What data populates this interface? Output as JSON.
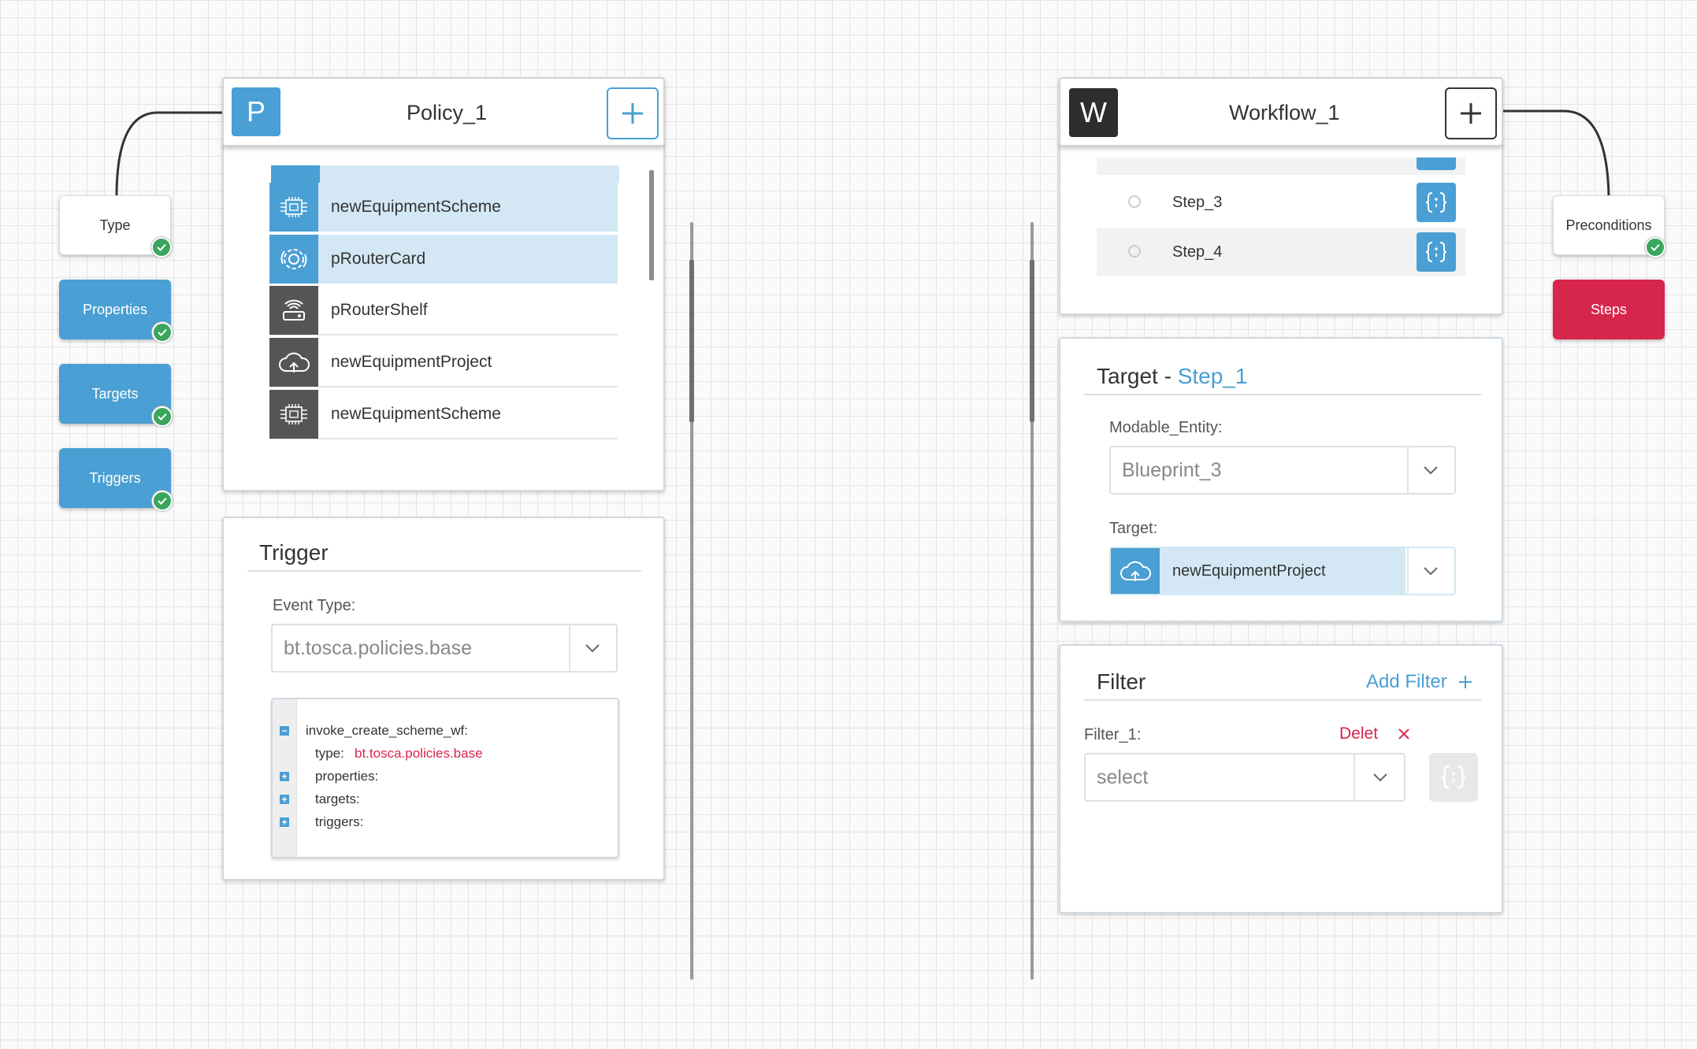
{
  "policy": {
    "badge": "P",
    "title": "Policy_1",
    "add_icon": "plus-icon",
    "nodes": [
      {
        "label": "Type",
        "checked": true
      },
      {
        "label": "Properties",
        "checked": true
      },
      {
        "label": "Targets",
        "checked": true
      },
      {
        "label": "Triggers",
        "checked": true
      }
    ],
    "items": [
      {
        "label": "newEquipmentScheme",
        "icon": "chip-icon",
        "selected": true
      },
      {
        "label": "pRouterCard",
        "icon": "gear-icon",
        "selected": true
      },
      {
        "label": "pRouterShelf",
        "icon": "router-icon",
        "selected": false
      },
      {
        "label": "newEquipmentProject",
        "icon": "cloud-icon",
        "selected": false
      },
      {
        "label": "newEquipmentScheme",
        "icon": "chip-icon",
        "selected": false
      }
    ],
    "trigger": {
      "title": "Trigger",
      "event_type_label": "Event Type:",
      "event_type_value": "bt.tosca.policies.base",
      "code": {
        "root": "invoke_create_scheme_wf:",
        "type_key": "type:",
        "type_value": "bt.tosca.policies.base",
        "properties": "properties:",
        "targets": "targets:",
        "triggers": "triggers:"
      }
    }
  },
  "workflow": {
    "badge": "W",
    "title": "Workflow_1",
    "add_icon": "plus-icon",
    "nodes": [
      {
        "label": "Preconditions",
        "checked": true
      },
      {
        "label": "Steps",
        "checked": false
      }
    ],
    "steps": [
      {
        "label": "Step_3",
        "icon": "braces-icon"
      },
      {
        "label": "Step_4",
        "icon": "braces-icon"
      }
    ],
    "target": {
      "title_prefix": "Target - ",
      "title_link": "Step_1",
      "entity_label": "Modable_Entity:",
      "entity_value": "Blueprint_3",
      "target_label": "Target:",
      "target_value": "newEquipmentProject"
    },
    "filter": {
      "title": "Filter",
      "add_filter": "Add Filter",
      "add_icon": "plus-icon",
      "filter_label": "Filter_1:",
      "delete_label": "Delet",
      "delete_icon": "close-icon",
      "select_placeholder": "select"
    }
  },
  "colors": {
    "blue": "#4a9fd4",
    "red": "#d7264c",
    "green": "#3aa55d",
    "selected_row": "#d3e8f4",
    "dark": "#333333"
  }
}
